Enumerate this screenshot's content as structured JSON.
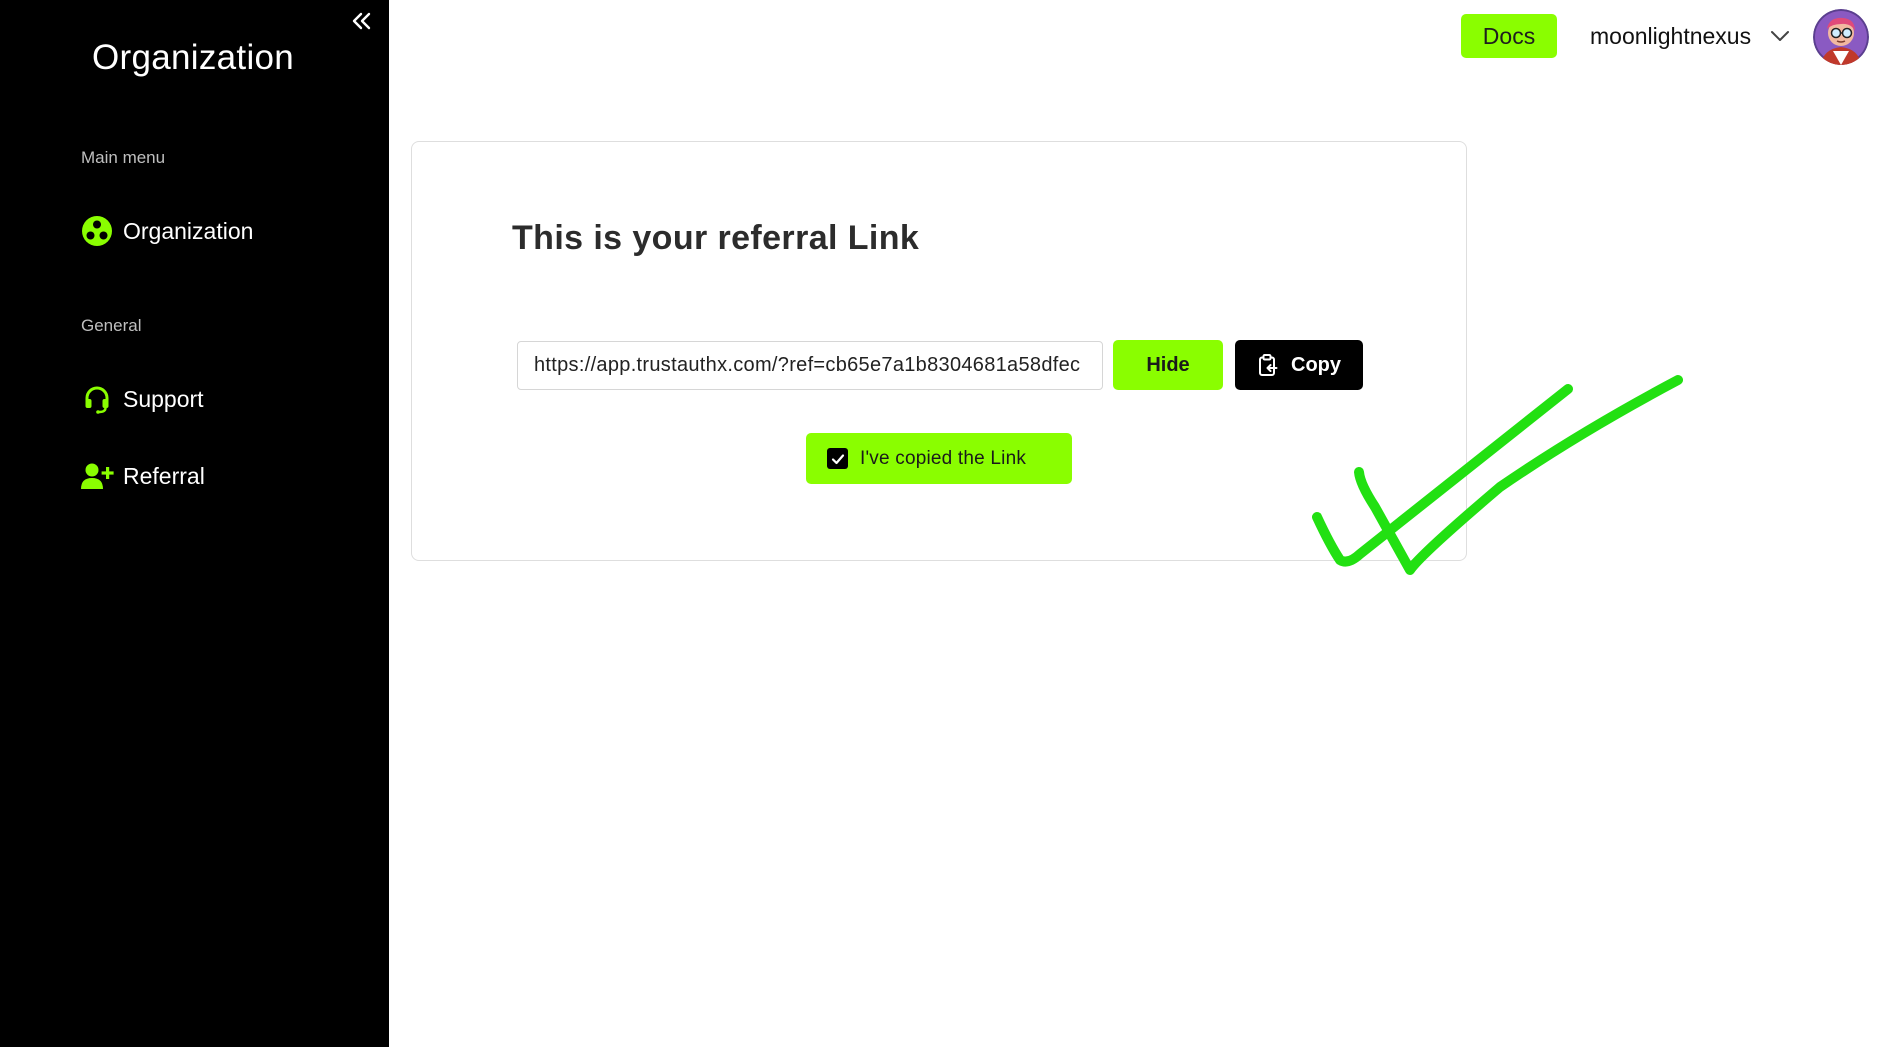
{
  "sidebar": {
    "title": "Organization",
    "collapse_icon": "double-chevron-left-icon",
    "sections": [
      {
        "label": "Main menu",
        "items": [
          {
            "label": "Organization",
            "icon": "organization-icon"
          }
        ]
      },
      {
        "label": "General",
        "items": [
          {
            "label": "Support",
            "icon": "headset-icon"
          },
          {
            "label": "Referral",
            "icon": "add-user-icon"
          }
        ]
      }
    ]
  },
  "header": {
    "docs_label": "Docs",
    "username": "moonlightnexus",
    "chevron_icon": "chevron-down-icon",
    "avatar_icon": "avatar"
  },
  "referral": {
    "title": "This is your referral Link",
    "link_value": "https://app.trustauthx.com/?ref=cb65e7a1b8304681a58dfec",
    "hide_label": "Hide",
    "copy_label": "Copy",
    "copy_icon": "clipboard-icon",
    "confirm_label": "I've copied the Link",
    "confirm_checked": true
  },
  "annotation": {
    "icon": "hand-drawn-checkmark",
    "color": "#22e012"
  },
  "colors": {
    "accent": "#8afe00",
    "sidebar_bg": "#000000",
    "annotation": "#22e012"
  }
}
